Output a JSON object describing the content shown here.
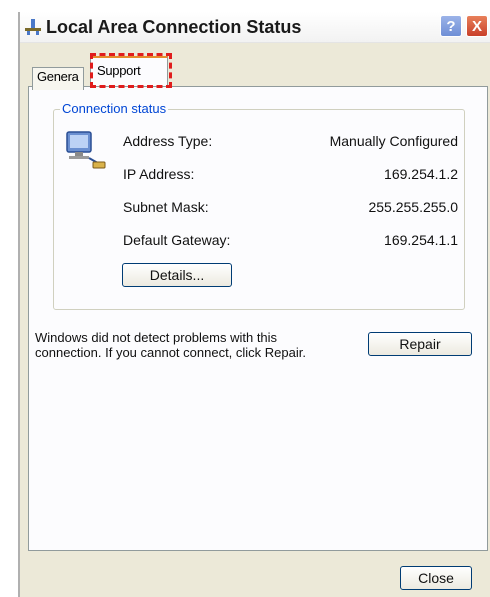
{
  "window": {
    "title": "Local Area Connection Status",
    "help_glyph": "?",
    "close_glyph": "X"
  },
  "tabs": {
    "general": "Genera",
    "support": "Support"
  },
  "connection_status": {
    "group_label": "Connection status",
    "rows": [
      {
        "label": "Address Type:",
        "value": "Manually Configured"
      },
      {
        "label": "IP Address:",
        "value": "169.254.1.2"
      },
      {
        "label": "Subnet Mask:",
        "value": "255.255.255.0"
      },
      {
        "label": "Default Gateway:",
        "value": "169.254.1.1"
      }
    ],
    "details_label": "Details..."
  },
  "repair": {
    "message": "Windows did not detect problems with this connection. If you cannot connect, click Repair.",
    "button_label": "Repair"
  },
  "footer": {
    "close_label": "Close"
  },
  "colors": {
    "highlight": "#e01c1c",
    "group_label": "#0046d5",
    "dialog_bg": "#ece9d8"
  }
}
